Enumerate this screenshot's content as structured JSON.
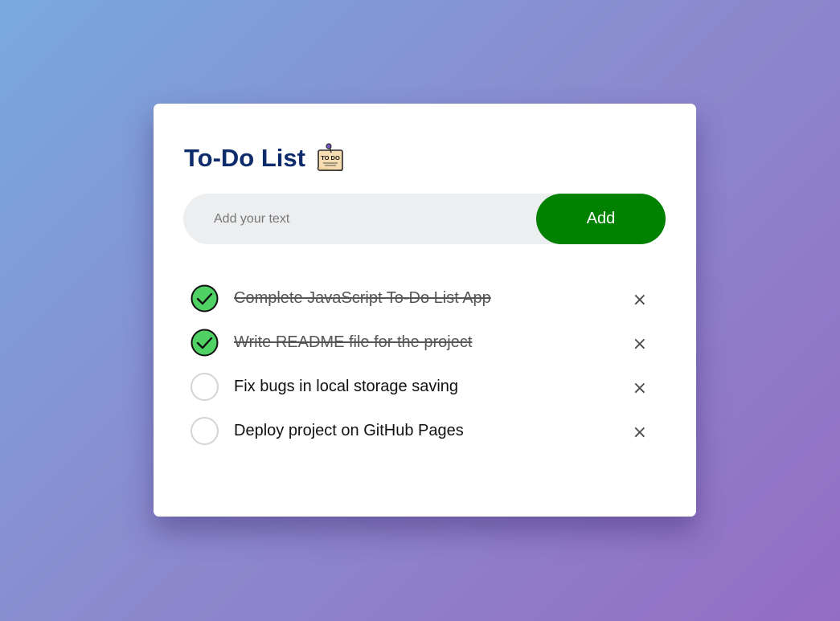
{
  "app": {
    "title": "To-Do List",
    "title_icon": "todo-note-icon",
    "title_icon_text": "TO DO"
  },
  "input": {
    "placeholder": "Add your text",
    "value": ""
  },
  "add_button": {
    "label": "Add",
    "color": "#008200"
  },
  "colors": {
    "title": "#0e2c6b",
    "check_fill": "#4fd263",
    "background_start": "#78a9df",
    "background_end": "#946dc2"
  },
  "tasks": [
    {
      "text": "Complete JavaScript To-Do List App",
      "done": true,
      "delete_label": "×"
    },
    {
      "text": "Write README file for the project",
      "done": true,
      "delete_label": "×"
    },
    {
      "text": "Fix bugs in local storage saving",
      "done": false,
      "delete_label": "×"
    },
    {
      "text": "Deploy project on GitHub Pages",
      "done": false,
      "delete_label": "×"
    }
  ]
}
